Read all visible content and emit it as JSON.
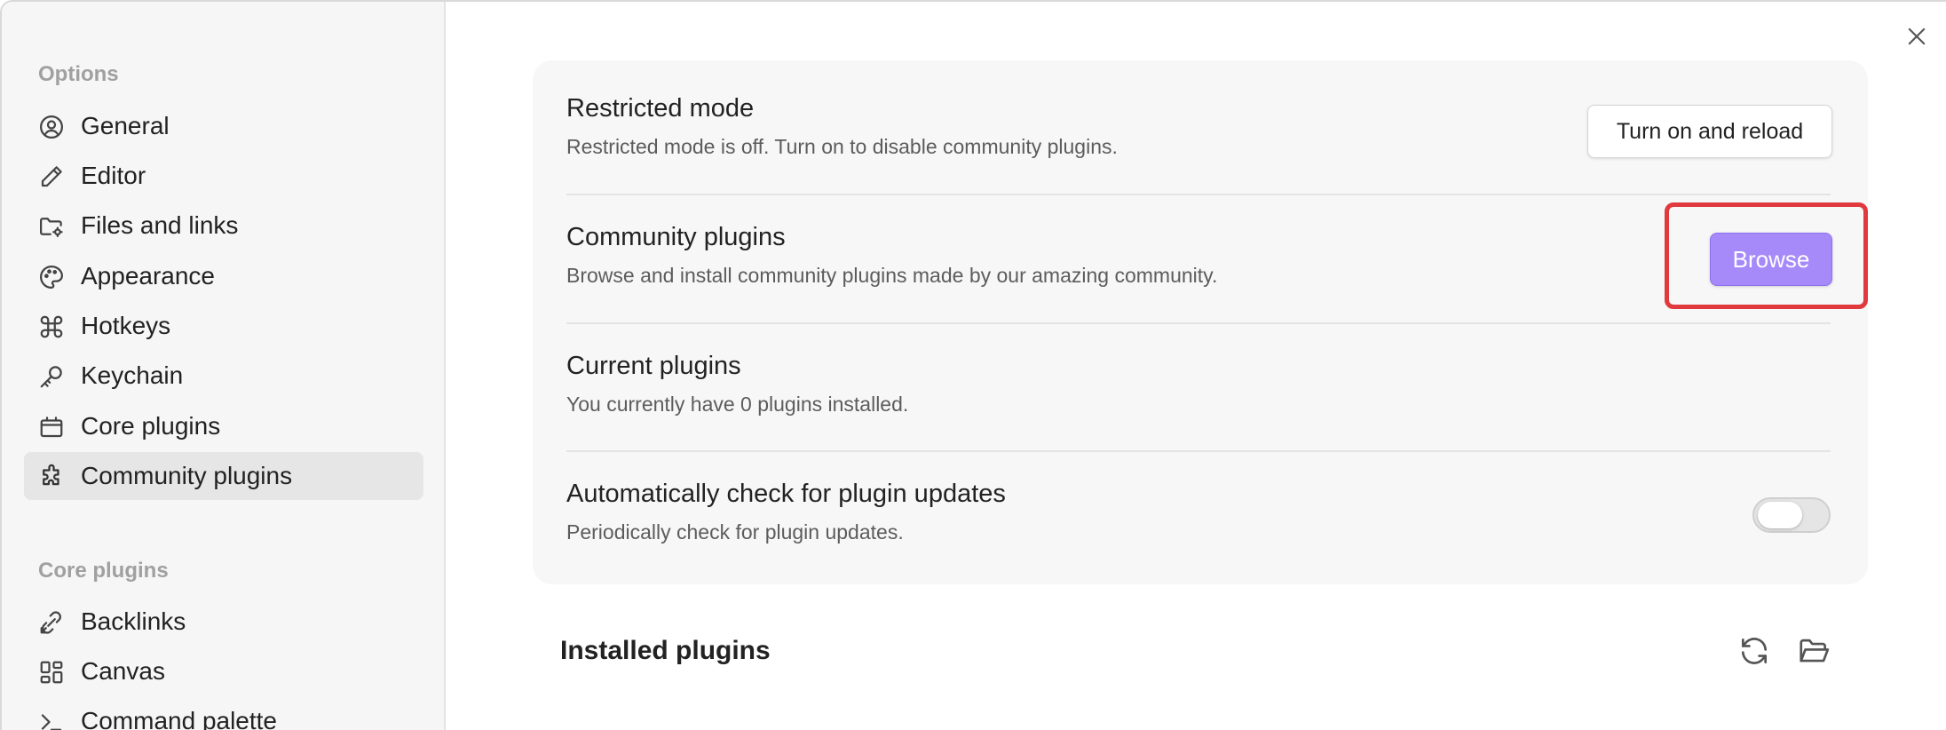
{
  "sidebar": {
    "options_heading": "Options",
    "options_items": [
      {
        "label": "General",
        "icon": "user-circle-icon"
      },
      {
        "label": "Editor",
        "icon": "pencil-icon"
      },
      {
        "label": "Files and links",
        "icon": "folder-gear-icon"
      },
      {
        "label": "Appearance",
        "icon": "palette-icon"
      },
      {
        "label": "Hotkeys",
        "icon": "command-key-icon"
      },
      {
        "label": "Keychain",
        "icon": "key-icon"
      },
      {
        "label": "Core plugins",
        "icon": "plugin-box-icon"
      },
      {
        "label": "Community plugins",
        "icon": "puzzle-icon",
        "active": true
      }
    ],
    "core_heading": "Core plugins",
    "core_items": [
      {
        "label": "Backlinks",
        "icon": "backlink-icon"
      },
      {
        "label": "Canvas",
        "icon": "grid-layout-icon"
      },
      {
        "label": "Command palette",
        "icon": "terminal-icon"
      }
    ]
  },
  "main": {
    "restricted_mode": {
      "title": "Restricted mode",
      "description": "Restricted mode is off. Turn on to disable community plugins.",
      "button_label": "Turn on and reload"
    },
    "community_plugins": {
      "title": "Community plugins",
      "description": "Browse and install community plugins made by our amazing community.",
      "button_label": "Browse"
    },
    "current_plugins": {
      "title": "Current plugins",
      "description": "You currently have 0 plugins installed."
    },
    "auto_update": {
      "title": "Automatically check for plugin updates",
      "description": "Periodically check for plugin updates.",
      "toggle_on": false
    },
    "installed_plugins_heading": "Installed plugins"
  },
  "colors": {
    "accent": "#a68af9",
    "highlight": "#e0393e"
  }
}
